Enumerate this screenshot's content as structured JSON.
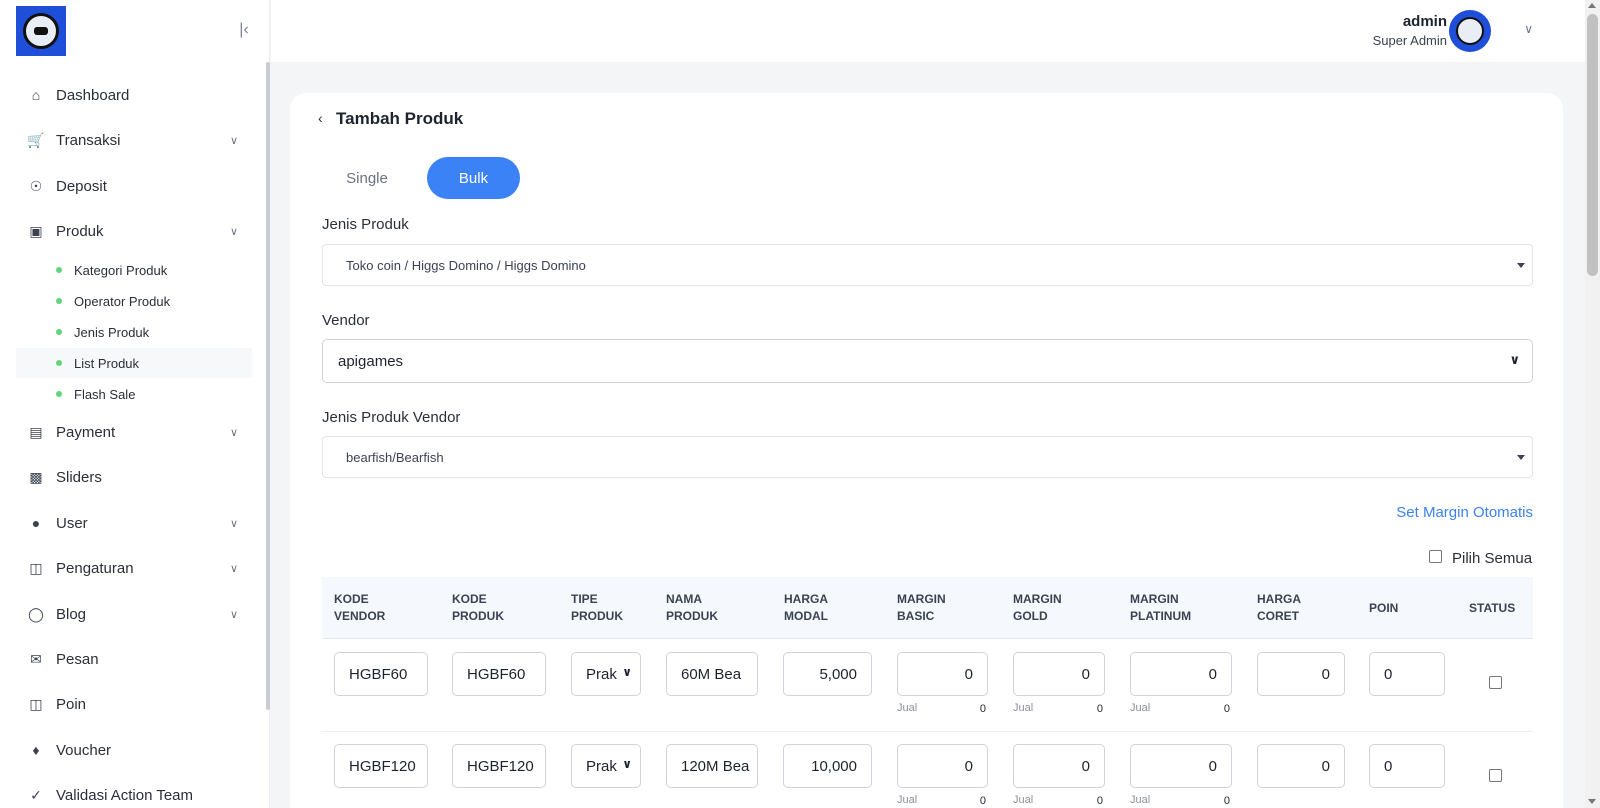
{
  "sidebar": {
    "items": [
      {
        "label": "Dashboard",
        "icon": "home-icon"
      },
      {
        "label": "Transaksi",
        "icon": "cart-icon"
      },
      {
        "label": "Deposit",
        "icon": "deposit-icon"
      },
      {
        "label": "Produk",
        "icon": "store-icon"
      },
      {
        "label": "Payment",
        "icon": "wallet-icon"
      },
      {
        "label": "Sliders",
        "icon": "image-icon"
      },
      {
        "label": "User",
        "icon": "user-icon"
      },
      {
        "label": "Pengaturan",
        "icon": "settings-icon"
      },
      {
        "label": "Blog",
        "icon": "globe-icon"
      },
      {
        "label": "Pesan",
        "icon": "mail-icon"
      },
      {
        "label": "Poin",
        "icon": "points-icon"
      },
      {
        "label": "Voucher",
        "icon": "voucher-icon"
      },
      {
        "label": "Validasi Action Team",
        "icon": "check-icon"
      }
    ],
    "produk_sub": [
      "Kategori Produk",
      "Operator Produk",
      "Jenis Produk",
      "List Produk",
      "Flash Sale"
    ]
  },
  "header": {
    "user_name": "admin",
    "user_role": "Super Admin"
  },
  "page": {
    "title": "Tambah Produk",
    "tabs": {
      "single": "Single",
      "bulk": "Bulk"
    },
    "jenis_produk_label": "Jenis Produk",
    "jenis_produk_value": "Toko coin / Higgs Domino / Higgs Domino",
    "vendor_label": "Vendor",
    "vendor_value": "apigames",
    "jenis_produk_vendor_label": "Jenis Produk Vendor",
    "jenis_produk_vendor_value": "bearfish/Bearfish",
    "set_margin_label": "Set Margin Otomatis",
    "pilih_semua_label": "Pilih Semua"
  },
  "table": {
    "headers": [
      [
        "KODE",
        "VENDOR"
      ],
      [
        "KODE",
        "PRODUK"
      ],
      [
        "TIPE",
        "PRODUK"
      ],
      [
        "NAMA",
        "PRODUK"
      ],
      [
        "HARGA",
        "MODAL"
      ],
      [
        "MARGIN",
        "BASIC"
      ],
      [
        "MARGIN",
        "GOLD"
      ],
      [
        "MARGIN",
        "PLATINUM"
      ],
      [
        "HARGA",
        "CORET"
      ],
      [
        "POIN",
        ""
      ],
      [
        "STATUS",
        ""
      ]
    ],
    "jual_label": "Jual",
    "rows": [
      {
        "kode_vendor": "HGBF60",
        "kode_produk": "HGBF60",
        "tipe": "Prak",
        "nama": "60M Bea",
        "harga_modal": "5,000",
        "margin_basic": "0",
        "margin_gold": "0",
        "margin_platinum": "0",
        "jual_basic": "0",
        "jual_gold": "0",
        "jual_platinum": "0",
        "harga_coret": "0",
        "poin": "0"
      },
      {
        "kode_vendor": "HGBF120",
        "kode_produk": "HGBF120",
        "tipe": "Prak",
        "nama": "120M Bea",
        "harga_modal": "10,000",
        "margin_basic": "0",
        "margin_gold": "0",
        "margin_platinum": "0",
        "jual_basic": "0",
        "jual_gold": "0",
        "jual_platinum": "0",
        "harga_coret": "0",
        "poin": "0"
      }
    ]
  }
}
